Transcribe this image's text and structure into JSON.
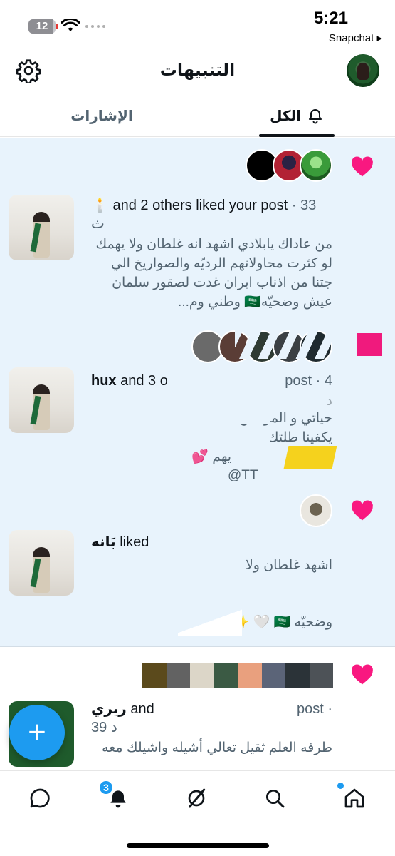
{
  "status_bar": {
    "battery_level": "12",
    "time": "5:21",
    "back_app": "Snapchat ▸"
  },
  "header": {
    "title": "التنبيهات",
    "settings_icon": "gear-icon",
    "avatar_icon": "profile-avatar"
  },
  "tabs": [
    {
      "label": "الكل",
      "icon": "bell-icon",
      "selected": true
    },
    {
      "label": "الإشارات",
      "selected": false
    }
  ],
  "notifications": [
    {
      "type": "like",
      "summary_prefix": "🕯️ ",
      "summary": "and 2 others liked your post",
      "meta": " · 33 ث",
      "excerpt": "من عاداك يابلادي اشهد انه غلطان ولا يهمك لو كثرت محاولاتهم الرديّه والصواريخ الي جتنا من اذناب ايران غدت لصقور سلمان عيش وضحيّه🇸🇦 وطني وم..."
    },
    {
      "type": "like",
      "summary_name": "hux",
      "summary": " and 3 o",
      "summary_tail": "post · 4",
      "meta_line": "د",
      "excerpt_line1": "حياتي و         المواطن",
      "excerpt_line2": "يكفينا طلتك      ",
      "excerpt_line3": "يهم 💕",
      "excerpt_line4": "@TT"
    },
    {
      "type": "like",
      "summary_name": "بَانه",
      "summary": " liked",
      "excerpt_line1": "اشهد      غلطان ولا",
      "excerpt_line2": "وضحيّه 🇸🇦 🤍 ✨"
    },
    {
      "type": "like",
      "read": true,
      "summary_name": "ريري",
      "summary": " and",
      "summary_tail": "post ·",
      "meta": "39 د",
      "excerpt": "طرفه العلم ثقيل تعالي أشيله واشيلك معه"
    }
  ],
  "fab": {
    "label": "+",
    "icon": "compose-plus-icon"
  },
  "bottom_nav": {
    "items": [
      {
        "name": "home",
        "icon": "home-icon"
      },
      {
        "name": "search",
        "icon": "search-icon"
      },
      {
        "name": "grok",
        "icon": "grok-icon"
      },
      {
        "name": "notifications",
        "icon": "bell-icon",
        "badge": "3"
      },
      {
        "name": "messages",
        "icon": "chat-icon"
      }
    ]
  },
  "colors": {
    "accent": "#1d9bf0",
    "heart": "#f91880",
    "unread_bg": "#e8f3fc",
    "secondary_text": "#536471"
  }
}
